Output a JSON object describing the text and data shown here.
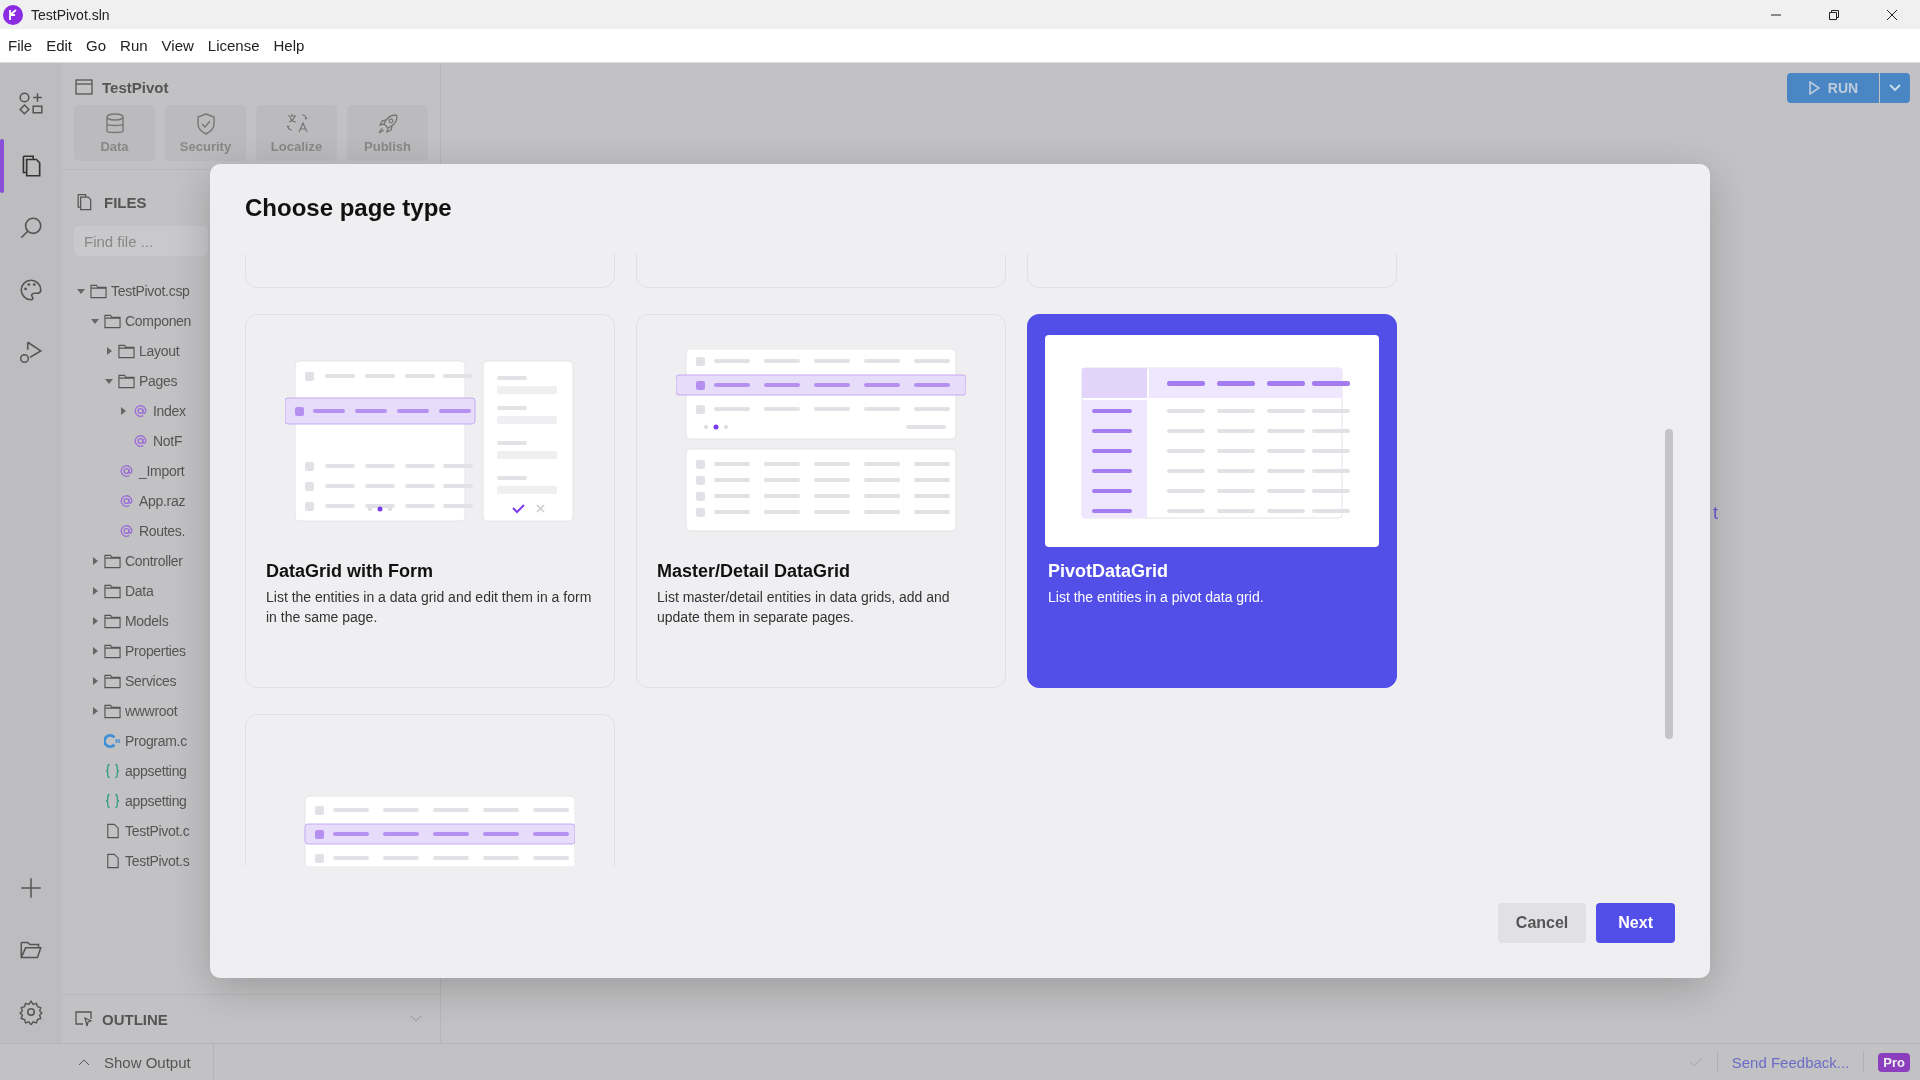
{
  "window": {
    "title": "TestPivot.sln"
  },
  "menu": [
    "File",
    "Edit",
    "Go",
    "Run",
    "View",
    "License",
    "Help"
  ],
  "activity_bar": [
    {
      "kind": "components",
      "selected": false
    },
    {
      "kind": "files",
      "selected": true
    },
    {
      "kind": "search",
      "selected": false
    },
    {
      "kind": "theme",
      "selected": false
    },
    {
      "kind": "debug",
      "selected": false
    }
  ],
  "project": {
    "title": "TestPivot",
    "tools": [
      {
        "kind": "data",
        "label": "Data"
      },
      {
        "kind": "security",
        "label": "Security"
      },
      {
        "kind": "localize",
        "label": "Localize"
      },
      {
        "kind": "publish",
        "label": "Publish"
      }
    ]
  },
  "files": {
    "title": "FILES",
    "search": {
      "placeholder": "Find file ..."
    },
    "tree": [
      {
        "name": "TestPivot.csp",
        "kind": "folder",
        "expanded": true,
        "children": [
          {
            "name": "Componen",
            "kind": "folder",
            "expanded": true,
            "children": [
              {
                "name": "Layout",
                "kind": "folder",
                "expanded": false
              },
              {
                "name": "Pages",
                "kind": "folder",
                "expanded": true,
                "children": [
                  {
                    "name": "Index",
                    "kind": "razor",
                    "expanded": false
                  },
                  {
                    "name": "NotF",
                    "kind": "razor"
                  }
                ]
              },
              {
                "name": "_Import",
                "kind": "razor"
              },
              {
                "name": "App.raz",
                "kind": "razor"
              },
              {
                "name": "Routes.",
                "kind": "razor"
              }
            ]
          },
          {
            "name": "Controller",
            "kind": "folder",
            "expanded": false
          },
          {
            "name": "Data",
            "kind": "folder",
            "expanded": false
          },
          {
            "name": "Models",
            "kind": "folder",
            "expanded": false
          },
          {
            "name": "Properties",
            "kind": "folder",
            "expanded": false
          },
          {
            "name": "Services",
            "kind": "folder",
            "expanded": false
          },
          {
            "name": "wwwroot",
            "kind": "folder",
            "expanded": false
          },
          {
            "name": "Program.c",
            "kind": "csharp"
          },
          {
            "name": "appsetting",
            "kind": "json"
          },
          {
            "name": "appsetting",
            "kind": "json"
          },
          {
            "name": "TestPivot.c",
            "kind": "file"
          },
          {
            "name": "TestPivot.s",
            "kind": "file"
          }
        ]
      }
    ]
  },
  "outline": {
    "title": "OUTLINE"
  },
  "run_button": {
    "label": "RUN"
  },
  "background_link": "t",
  "dialog": {
    "title": "Choose page type",
    "cards": [
      {
        "kind": "clipped",
        "selected": false
      },
      {
        "kind": "clipped",
        "selected": false
      },
      {
        "kind": "clipped",
        "selected": false
      },
      {
        "kind": "grid-form",
        "selected": false,
        "title": "DataGrid with Form",
        "description": "List the entities in a data grid and edit them in a form in the same page."
      },
      {
        "kind": "master-detail",
        "selected": false,
        "title": "Master/Detail DataGrid",
        "description": "List master/detail entities in data grids, add and update them in separate pages."
      },
      {
        "kind": "pivot",
        "selected": true,
        "title": "PivotDataGrid",
        "description": "List the entities in a pivot data grid."
      },
      {
        "kind": "grid",
        "selected": false
      }
    ],
    "buttons": [
      {
        "kind": "secondary",
        "label": "Cancel"
      },
      {
        "kind": "primary",
        "label": "Next"
      }
    ]
  },
  "status_bar": {
    "output": "Show Output",
    "feedback": "Send Feedback...",
    "badge": "Pro"
  }
}
